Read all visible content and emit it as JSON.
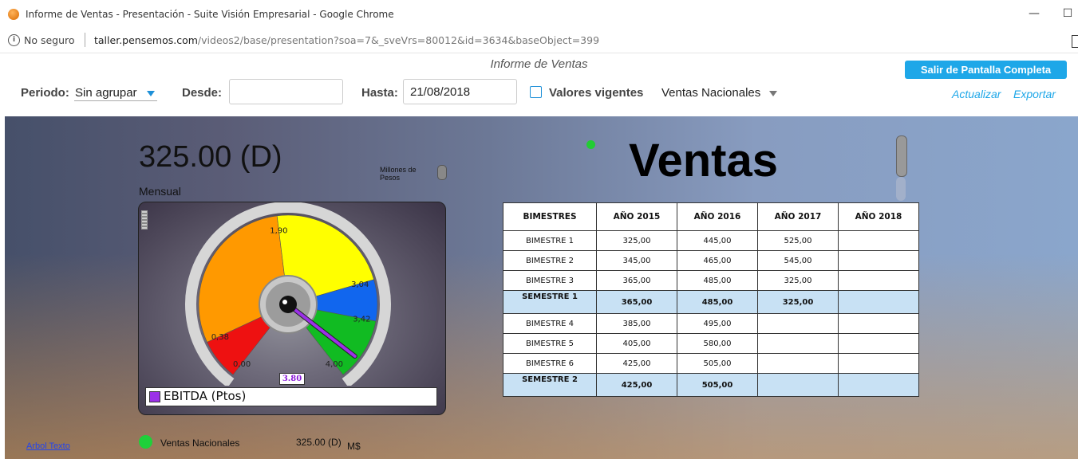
{
  "window": {
    "title": "Informe de Ventas - Presentación - Suite Visión Empresarial - Google Chrome",
    "minimize_glyph": "—",
    "maximize_glyph": "☐"
  },
  "address": {
    "security": "No seguro",
    "host": "taller.pensemos.com",
    "path": "/videos2/base/presentation?soa=7&_sveVrs=80012&id=3634&baseObject=399"
  },
  "report": {
    "title": "Informe de Ventas",
    "exit_fullscreen": "Salir de Pantalla Completa",
    "period_label": "Periodo:",
    "period_value": "Sin agrupar",
    "from_label": "Desde:",
    "from_value": "",
    "to_label": "Hasta:",
    "to_value": "21/08/2018",
    "current_values_label": "Valores vigentes",
    "current_values_checked": false,
    "indicator_select": "Ventas Nacionales",
    "refresh": "Actualizar",
    "export": "Exportar",
    "accent_color": "#1ea7e8"
  },
  "kpi": {
    "value": "325.00 (D)",
    "period": "Mensual",
    "units": "Millones de Pesos"
  },
  "gauge": {
    "min": 0,
    "max": 4,
    "needle_value": 3.8,
    "value_label": "3.80",
    "bands": [
      {
        "from": 0.0,
        "to": 0.38,
        "color": "#ee1111"
      },
      {
        "from": 0.38,
        "to": 1.9,
        "color": "#ff9900"
      },
      {
        "from": 1.9,
        "to": 3.04,
        "color": "#ffff00"
      },
      {
        "from": 3.04,
        "to": 3.42,
        "color": "#1166ee"
      },
      {
        "from": 3.42,
        "to": 4.0,
        "color": "#11bb22"
      }
    ],
    "tick_labels": [
      {
        "value": 0.0,
        "text": "0,00"
      },
      {
        "value": 0.38,
        "text": "0,38"
      },
      {
        "value": 1.9,
        "text": "1,90"
      },
      {
        "value": 3.04,
        "text": "3,04"
      },
      {
        "value": 3.42,
        "text": "3,42"
      },
      {
        "value": 4.0,
        "text": "4,00"
      }
    ],
    "legend": "EBITDA (Ptos)",
    "needle_color": "#9b30e8"
  },
  "ventas": {
    "title": "Ventas",
    "headers": [
      "BIMESTRES",
      "AÑO 2015",
      "AÑO 2016",
      "AÑO 2017",
      "AÑO 2018"
    ],
    "rows": [
      {
        "cells": [
          "BIMESTRE 1",
          "325,00",
          "445,00",
          "525,00",
          ""
        ],
        "semester": false
      },
      {
        "cells": [
          "BIMESTRE 2",
          "345,00",
          "465,00",
          "545,00",
          ""
        ],
        "semester": false
      },
      {
        "cells": [
          "BIMESTRE 3",
          "365,00",
          "485,00",
          "325,00",
          ""
        ],
        "semester": false
      },
      {
        "cells": [
          "SEMESTRE 1",
          "365,00",
          "485,00",
          "325,00",
          ""
        ],
        "semester": true
      },
      {
        "cells": [
          "BIMESTRE 4",
          "385,00",
          "495,00",
          "",
          ""
        ],
        "semester": false
      },
      {
        "cells": [
          "BIMESTRE 5",
          "405,00",
          "580,00",
          "",
          ""
        ],
        "semester": false
      },
      {
        "cells": [
          "BIMESTRE 6",
          "425,00",
          "505,00",
          "",
          ""
        ],
        "semester": false
      },
      {
        "cells": [
          "SEMESTRE 2",
          "425,00",
          "505,00",
          "",
          ""
        ],
        "semester": true
      }
    ]
  },
  "footer": {
    "tree_link": "Arbol Texto",
    "indicator_name": "Ventas Nacionales",
    "indicator_value": "325.00 (D)",
    "indicator_unit": "M$"
  }
}
